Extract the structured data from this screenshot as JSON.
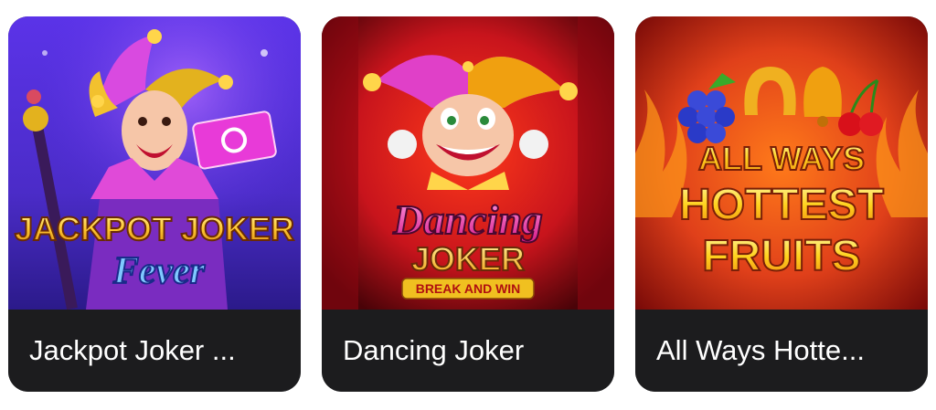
{
  "games": [
    {
      "title": "Jackpot Joker ...",
      "art_line1": "JACKPOT",
      "art_line1b": "JOKER",
      "art_line2": "Fever"
    },
    {
      "title": "Dancing Joker",
      "art_line1": "Dancing",
      "art_line2": "JOKER",
      "art_line3": "BREAK AND WIN"
    },
    {
      "title": "All Ways Hotte...",
      "art_line1": "ALL WAYS",
      "art_line2": "HOTTEST",
      "art_line3": "FRUITS"
    }
  ],
  "colors": {
    "caption_bg": "#1c1c1e",
    "caption_text": "#ffffff",
    "card1_bg": "#4a2bd8",
    "card2_bg": "#c8141c",
    "card3_bg": "#e0401a"
  }
}
